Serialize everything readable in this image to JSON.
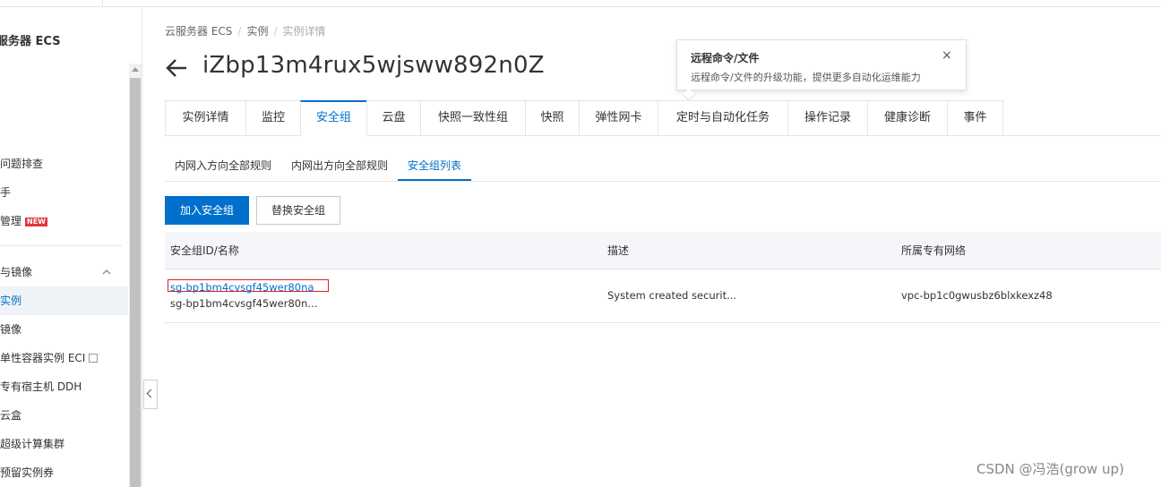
{
  "sidebar": {
    "title": "服务器 ECS",
    "items": [
      {
        "label": "问题排查"
      },
      {
        "label": "手"
      },
      {
        "label": "管理",
        "badge": "NEW"
      },
      {
        "label": "与镜像"
      },
      {
        "label": "实例"
      },
      {
        "label": "镜像"
      },
      {
        "label": "单性容器实例 ECI"
      },
      {
        "label": "专有宿主机 DDH"
      },
      {
        "label": "云盒"
      },
      {
        "label": "超级计算集群"
      },
      {
        "label": "预留实例券"
      }
    ]
  },
  "breadcrumb": [
    "云服务器 ECS",
    "实例",
    "实例详情"
  ],
  "page": {
    "title": "iZbp13m4rux5wjsww892n0Z"
  },
  "tooltip": {
    "title": "远程命令/文件",
    "desc": "远程命令/文件的升级功能，提供更多自动化运维能力",
    "close": "×"
  },
  "tabs": [
    {
      "label": "实例详情"
    },
    {
      "label": "监控"
    },
    {
      "label": "安全组"
    },
    {
      "label": "云盘"
    },
    {
      "label": "快照一致性组"
    },
    {
      "label": "快照"
    },
    {
      "label": "弹性网卡"
    },
    {
      "label": "定时与自动化任务"
    },
    {
      "label": "操作记录"
    },
    {
      "label": "健康诊断"
    },
    {
      "label": "事件"
    }
  ],
  "subtabs": [
    {
      "label": "内网入方向全部规则"
    },
    {
      "label": "内网出方向全部规则"
    },
    {
      "label": "安全组列表"
    }
  ],
  "buttons": {
    "add": "加入安全组",
    "replace": "替换安全组"
  },
  "table": {
    "headers": [
      "安全组ID/名称",
      "描述",
      "所属专有网络"
    ],
    "rows": [
      {
        "id": "sg-bp1bm4cvsgf45wer80na",
        "name": "sg-bp1bm4cvsgf45wer80n...",
        "desc": "System created securit...",
        "vpc": "vpc-bp1c0gwusbz6blxkexz48"
      }
    ]
  },
  "watermark": "CSDN @冯浩(grow up)",
  "colors": {
    "accent": "#0070cc",
    "highlight": "#e0202a"
  }
}
